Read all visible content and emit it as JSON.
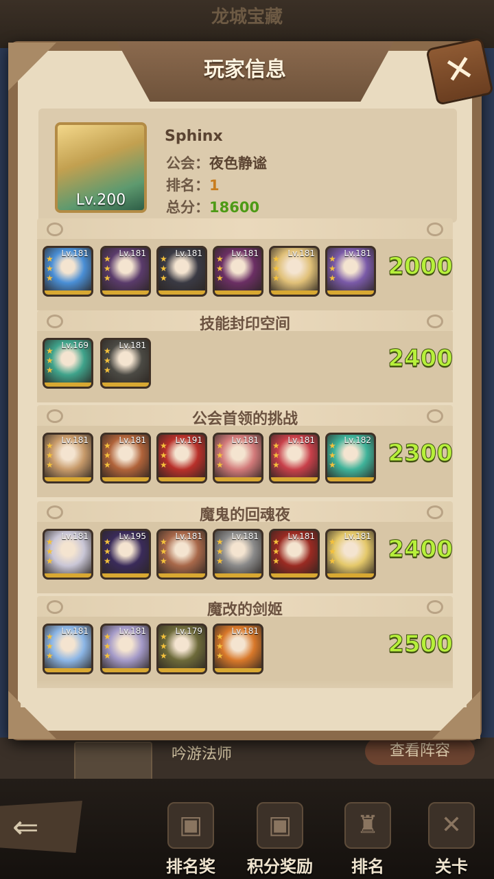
{
  "background": {
    "title": "龙城宝藏",
    "row_name": "吟游法师",
    "row_button": "查看阵容"
  },
  "panel": {
    "title": "玩家信息",
    "close_label": "✕"
  },
  "player": {
    "name": "Sphinx",
    "level_label": "Lv.200",
    "guild_label": "公会：",
    "guild": "夜色静谧",
    "rank_label": "排名：",
    "rank": "1",
    "score_label": "总分：",
    "score": "18600"
  },
  "sections": [
    {
      "title": "",
      "score": "2000",
      "heroes": [
        {
          "level": "Lv.181",
          "color": "#4a8fd6"
        },
        {
          "level": "Lv.181",
          "color": "#5a3b6b"
        },
        {
          "level": "Lv.181",
          "color": "#3a3a44"
        },
        {
          "level": "Lv.181",
          "color": "#6b2f64"
        },
        {
          "level": "Lv.181",
          "color": "#e0c078"
        },
        {
          "level": "Lv.181",
          "color": "#7a5aa8"
        }
      ]
    },
    {
      "title": "技能封印空间",
      "score": "2400",
      "heroes": [
        {
          "level": "Lv.169",
          "color": "#3fa38b"
        },
        {
          "level": "Lv.181",
          "color": "#4b4a44"
        }
      ]
    },
    {
      "title": "公会首领的挑战",
      "score": "2300",
      "heroes": [
        {
          "level": "Lv.181",
          "color": "#c79a6a"
        },
        {
          "level": "Lv.181",
          "color": "#b0633a"
        },
        {
          "level": "Lv.191",
          "color": "#b8302a"
        },
        {
          "level": "Lv.181",
          "color": "#d27a7a"
        },
        {
          "level": "Lv.181",
          "color": "#c8404a"
        },
        {
          "level": "Lv.182",
          "color": "#3fb39a"
        }
      ]
    },
    {
      "title": "魔鬼的回魂夜",
      "score": "2400",
      "heroes": [
        {
          "level": "Lv.181",
          "color": "#c9c6d6"
        },
        {
          "level": "Lv.195",
          "color": "#3a2b5a"
        },
        {
          "level": "Lv.181",
          "color": "#a8684a"
        },
        {
          "level": "Lv.181",
          "color": "#8a8a8a"
        },
        {
          "level": "Lv.181",
          "color": "#9a2a22"
        },
        {
          "level": "Lv.181",
          "color": "#e4c86a"
        }
      ]
    },
    {
      "title": "魔改的剑姬",
      "score": "2500",
      "heroes": [
        {
          "level": "Lv.181",
          "color": "#8cb6e6"
        },
        {
          "level": "Lv.181",
          "color": "#a49ac8"
        },
        {
          "level": "Lv.179",
          "color": "#6d6a3a"
        },
        {
          "level": "Lv.181",
          "color": "#d8782a"
        }
      ]
    }
  ],
  "nav": {
    "back_label": "⇐",
    "items": [
      {
        "label": "排名奖",
        "icon": "▣"
      },
      {
        "label": "积分奖励",
        "icon": "▣"
      },
      {
        "label": "排名",
        "icon": "♜"
      },
      {
        "label": "关卡",
        "icon": "✕"
      }
    ]
  },
  "colors": {
    "score_green": "#b7f03b",
    "rank_orange": "#c87d1e",
    "total_green": "#4e9a16"
  }
}
